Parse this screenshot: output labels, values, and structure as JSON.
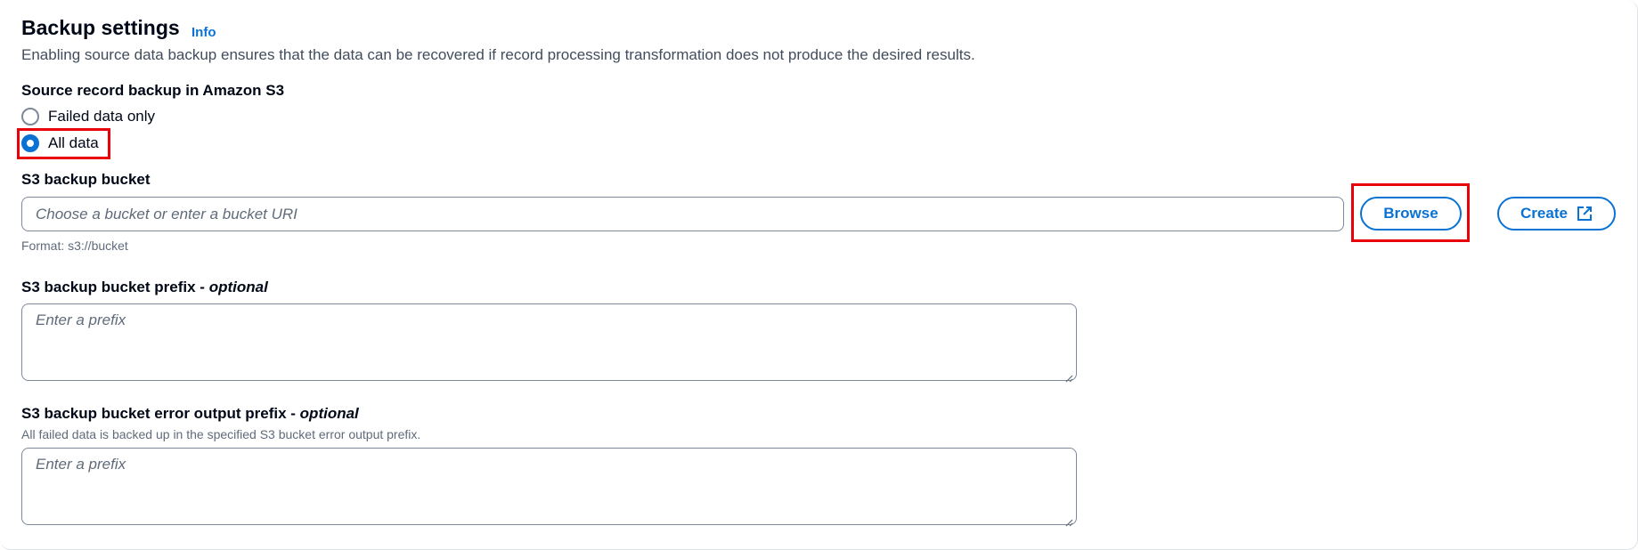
{
  "header": {
    "title": "Backup settings",
    "info_label": "Info",
    "description": "Enabling source data backup ensures that the data can be recovered if record processing transformation does not produce the desired results."
  },
  "source_backup": {
    "label": "Source record backup in Amazon S3",
    "options": [
      {
        "label": "Failed data only",
        "selected": false
      },
      {
        "label": "All data",
        "selected": true
      }
    ]
  },
  "bucket": {
    "label": "S3 backup bucket",
    "placeholder": "Choose a bucket or enter a bucket URI",
    "hint": "Format: s3://bucket",
    "browse_label": "Browse",
    "create_label": "Create"
  },
  "prefix": {
    "label": "S3 backup bucket prefix - ",
    "optional": "optional",
    "placeholder": "Enter a prefix"
  },
  "error_prefix": {
    "label": "S3 backup bucket error output prefix - ",
    "optional": "optional",
    "hint": "All failed data is backed up in the specified S3 bucket error output prefix.",
    "placeholder": "Enter a prefix"
  },
  "colors": {
    "accent": "#0972d3",
    "highlight": "#e8000b",
    "text": "#000716",
    "muted": "#5f6b7a"
  },
  "icons": {
    "create": "external-link-icon",
    "grip": "resize-grip-icon"
  }
}
